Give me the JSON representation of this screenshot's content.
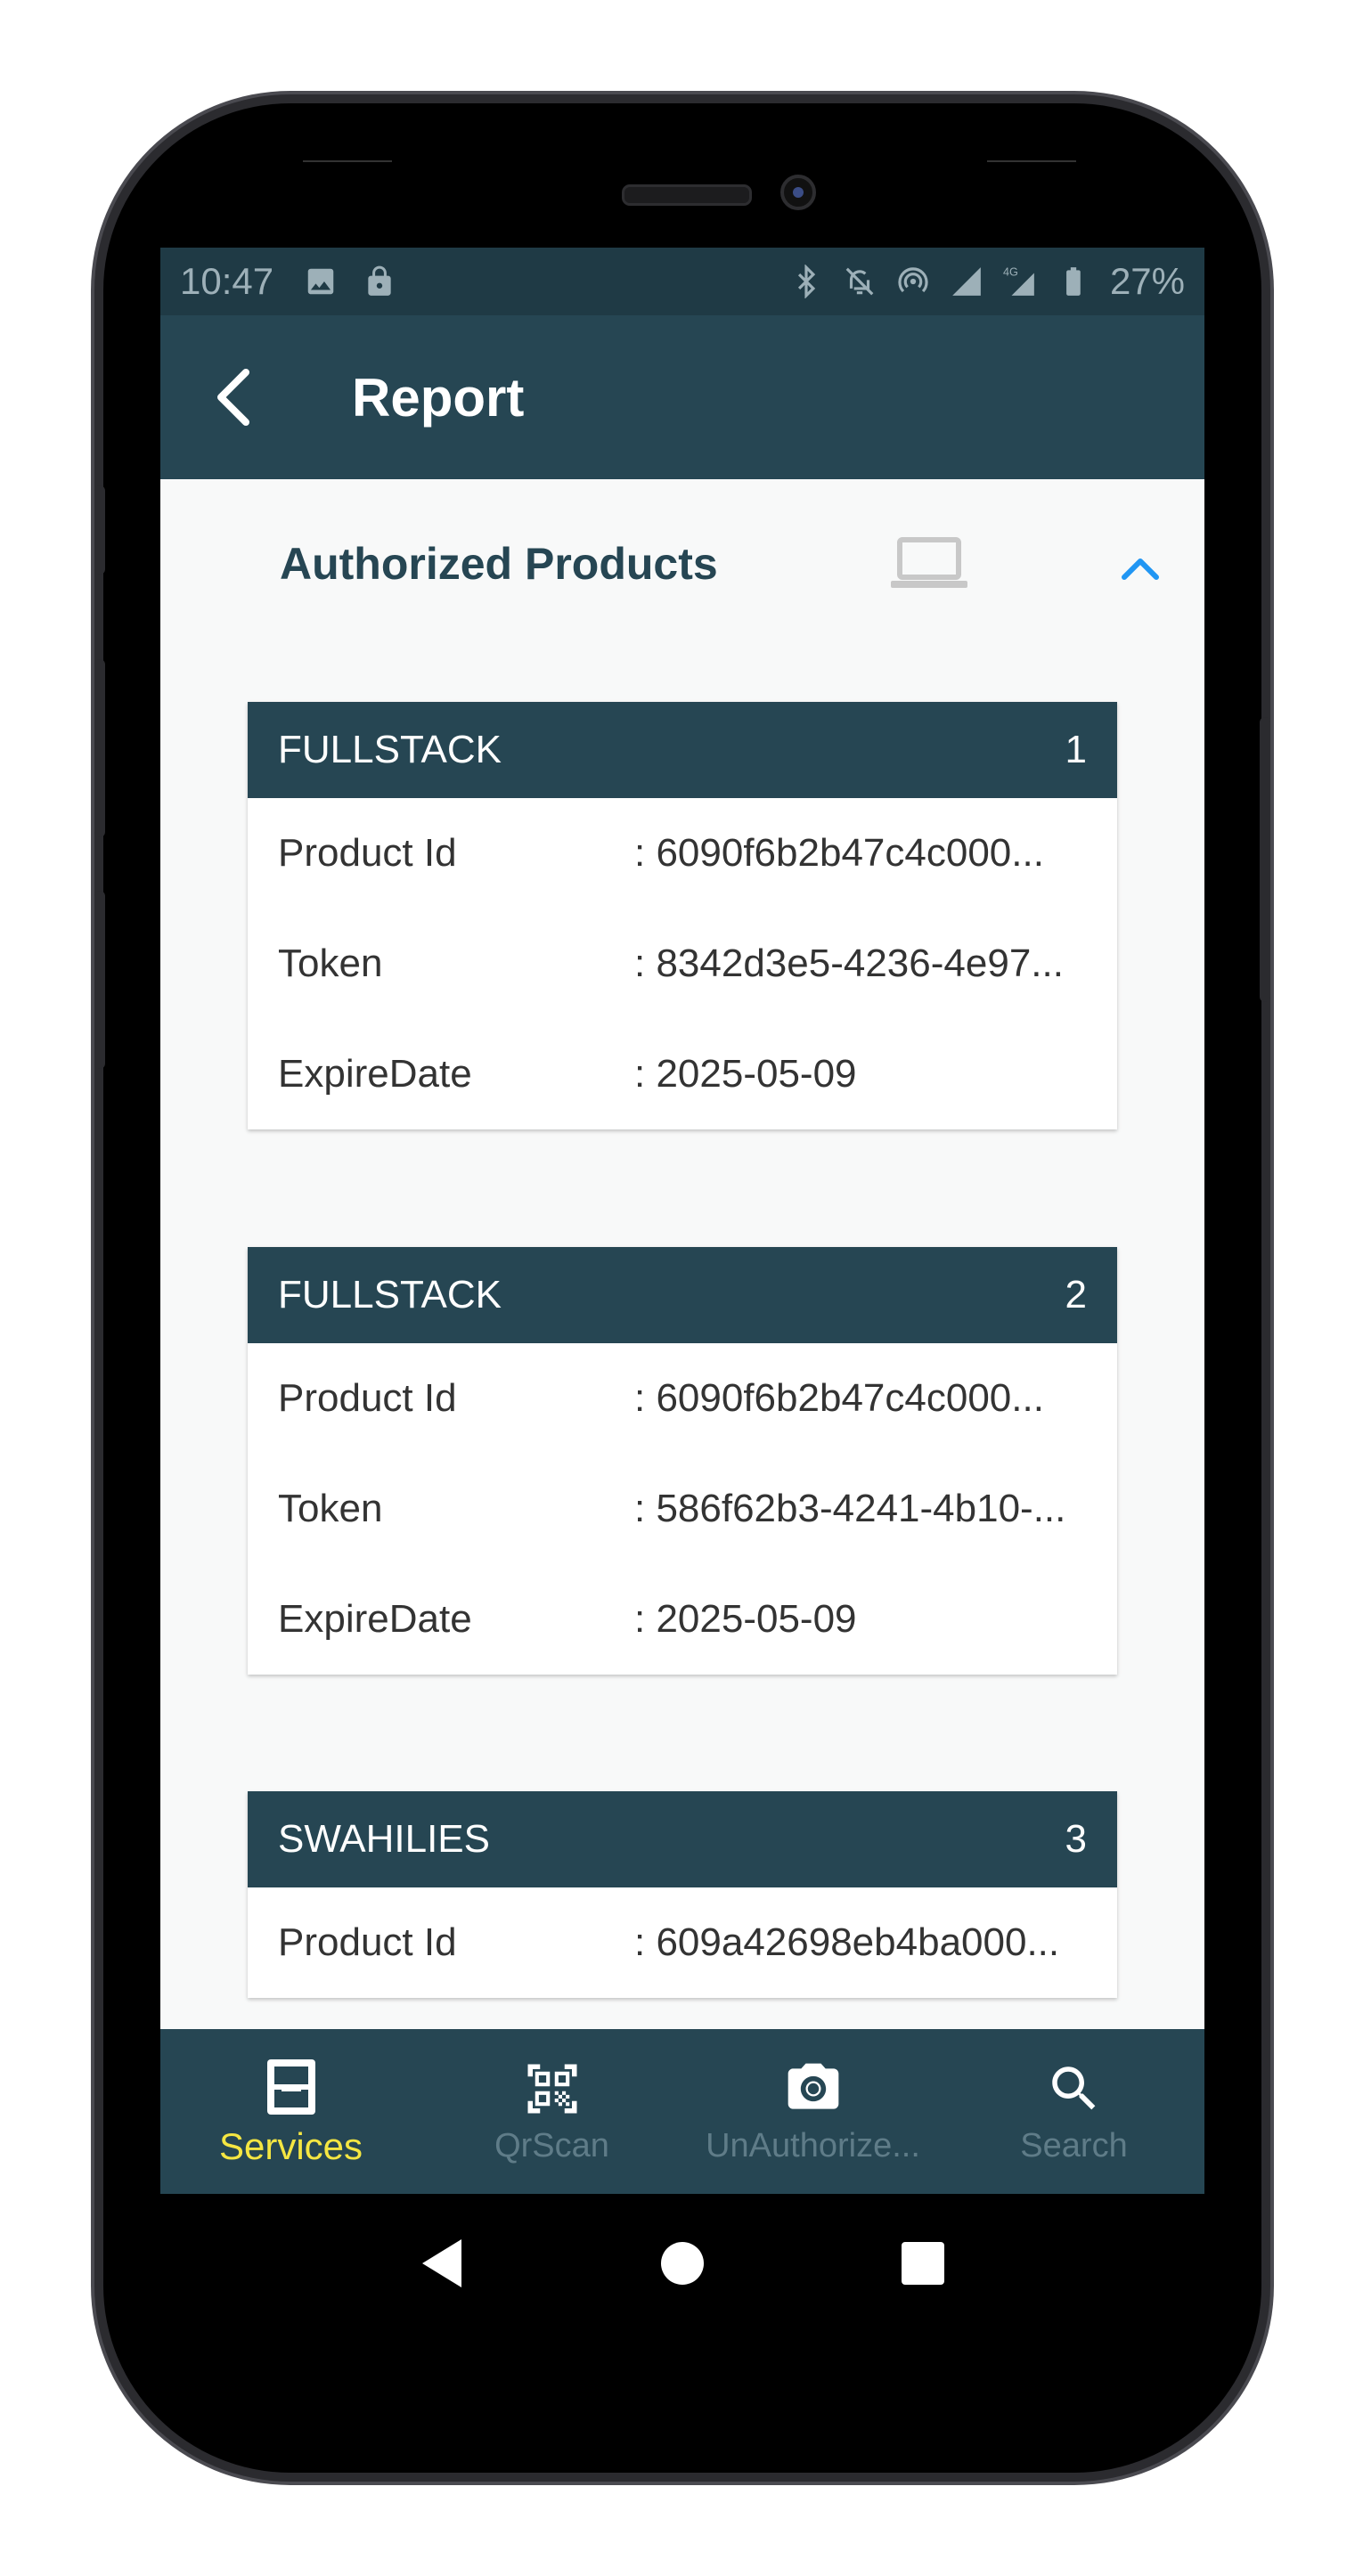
{
  "status_bar": {
    "time": "10:47",
    "battery": "27%",
    "network": "4G"
  },
  "app_bar": {
    "title": "Report"
  },
  "section": {
    "title": "Authorized Products"
  },
  "cards": [
    {
      "name": "FULLSTACK",
      "index": "1",
      "rows": [
        {
          "label": "Product Id",
          "value": ":   6090f6b2b47c4c000..."
        },
        {
          "label": "Token",
          "value": ":  8342d3e5-4236-4e97..."
        },
        {
          "label": "ExpireDate",
          "value": ": 2025-05-09"
        }
      ]
    },
    {
      "name": "FULLSTACK",
      "index": "2",
      "rows": [
        {
          "label": "Product Id",
          "value": ":   6090f6b2b47c4c000..."
        },
        {
          "label": "Token",
          "value": ": 586f62b3-4241-4b10-..."
        },
        {
          "label": "ExpireDate",
          "value": ": 2025-05-09"
        }
      ]
    },
    {
      "name": "SWAHILIES",
      "index": "3",
      "rows": [
        {
          "label": "Product Id",
          "value": ":  609a42698eb4ba000..."
        }
      ]
    }
  ],
  "bottom_nav": [
    {
      "label": "Services",
      "icon": "services-icon",
      "active": true
    },
    {
      "label": "QrScan",
      "icon": "qr-scan-icon",
      "active": false
    },
    {
      "label": "UnAuthorize...",
      "icon": "camera-icon",
      "active": false
    },
    {
      "label": "Search",
      "icon": "search-icon",
      "active": false
    }
  ],
  "colors": {
    "primary": "#264653",
    "active_nav": "#f5e642",
    "accent": "#2196f3",
    "background": "#f8f9f9"
  }
}
